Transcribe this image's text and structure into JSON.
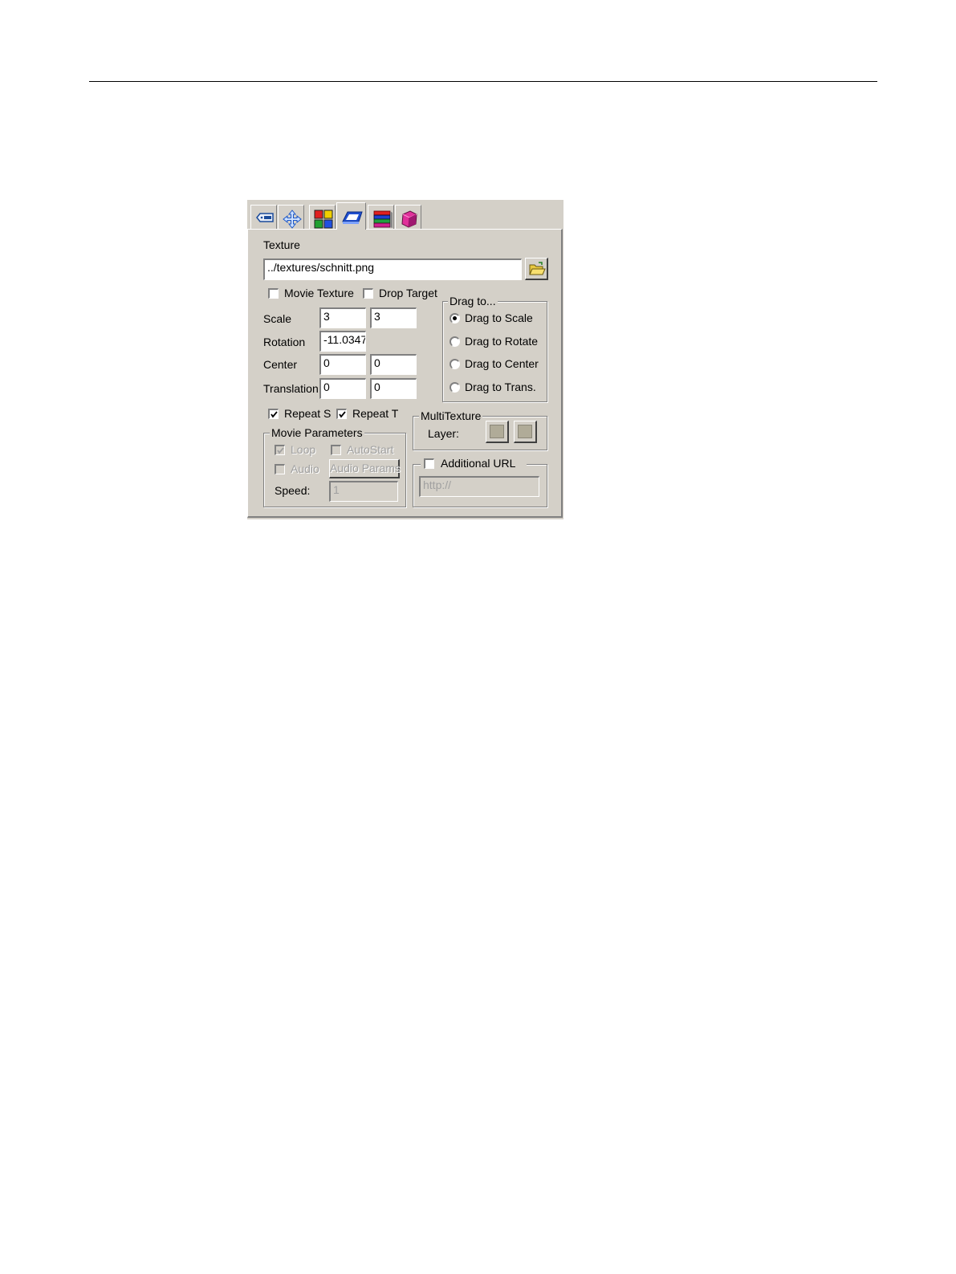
{
  "texture": {
    "label": "Texture",
    "path": "../textures/schnitt.png"
  },
  "options": {
    "movie_texture": {
      "label": "Movie Texture",
      "checked": false
    },
    "drop_target": {
      "label": "Drop Target",
      "checked": false
    }
  },
  "transform": {
    "scale": {
      "label": "Scale",
      "s": "3",
      "t": "3"
    },
    "rotation": {
      "label": "Rotation",
      "value": "-11.0347"
    },
    "center": {
      "label": "Center",
      "s": "0",
      "t": "0"
    },
    "translation": {
      "label": "Translation",
      "s": "0",
      "t": "0"
    }
  },
  "drag_to": {
    "legend": "Drag to...",
    "items": [
      {
        "label": "Drag to Scale",
        "selected": true
      },
      {
        "label": "Drag to Rotate",
        "selected": false
      },
      {
        "label": "Drag to Center",
        "selected": false
      },
      {
        "label": "Drag to Trans.",
        "selected": false
      }
    ]
  },
  "repeat": {
    "s": {
      "label": "Repeat S",
      "checked": true
    },
    "t": {
      "label": "Repeat T",
      "checked": true
    }
  },
  "multitexture": {
    "legend": "MultiTexture",
    "layer_label": "Layer:"
  },
  "movie_params": {
    "legend": "Movie Parameters",
    "loop": {
      "label": "Loop",
      "checked": true
    },
    "autostart": {
      "label": "AutoStart",
      "checked": false
    },
    "audio": {
      "label": "Audio",
      "checked": false
    },
    "audio_params_button": "Audio Params",
    "speed_label": "Speed:",
    "speed_value": "1"
  },
  "additional_url": {
    "label": "Additional URL",
    "checked": false,
    "placeholder": "http://"
  },
  "tabs": [
    {
      "icon": "id-tag-icon"
    },
    {
      "icon": "move-arrows-icon"
    },
    {
      "icon": "color-grid-icon"
    },
    {
      "icon": "texture-plane-icon"
    },
    {
      "icon": "layers-icon"
    },
    {
      "icon": "cube-icon"
    }
  ]
}
